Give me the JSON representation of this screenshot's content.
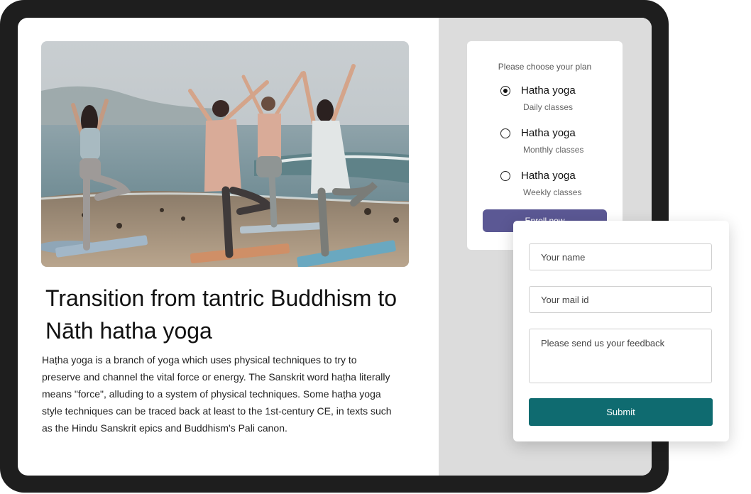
{
  "article": {
    "title": "Transition from tantric Buddhism to Nāth hatha yoga",
    "body": "Haṭha yoga is a branch of yoga which uses physical techniques to try to preserve and channel the vital force or energy. The Sanskrit word haṭha literally means \"force\", alluding to a system of physical techniques. Some haṭha yoga style techniques can be traced back at least to the 1st-century CE, in texts such as the Hindu Sanskrit epics and Buddhism's Pali canon."
  },
  "plan": {
    "heading": "Please choose your plan",
    "options": [
      {
        "name": "Hatha yoga",
        "sub": "Daily classes",
        "selected": true
      },
      {
        "name": "Hatha yoga",
        "sub": "Monthly classes",
        "selected": false
      },
      {
        "name": "Hatha yoga",
        "sub": "Weekly classes",
        "selected": false
      }
    ],
    "enroll_label": "Enroll now"
  },
  "form": {
    "name_placeholder": "Your name",
    "mail_placeholder": "Your mail id",
    "feedback_placeholder": "Please send us your feedback",
    "submit_label": "Submit"
  },
  "colors": {
    "enroll": "#5b5894",
    "submit": "#0f6b70",
    "device_frame": "#1e1e1e",
    "side_panel": "#dcdcdc"
  }
}
